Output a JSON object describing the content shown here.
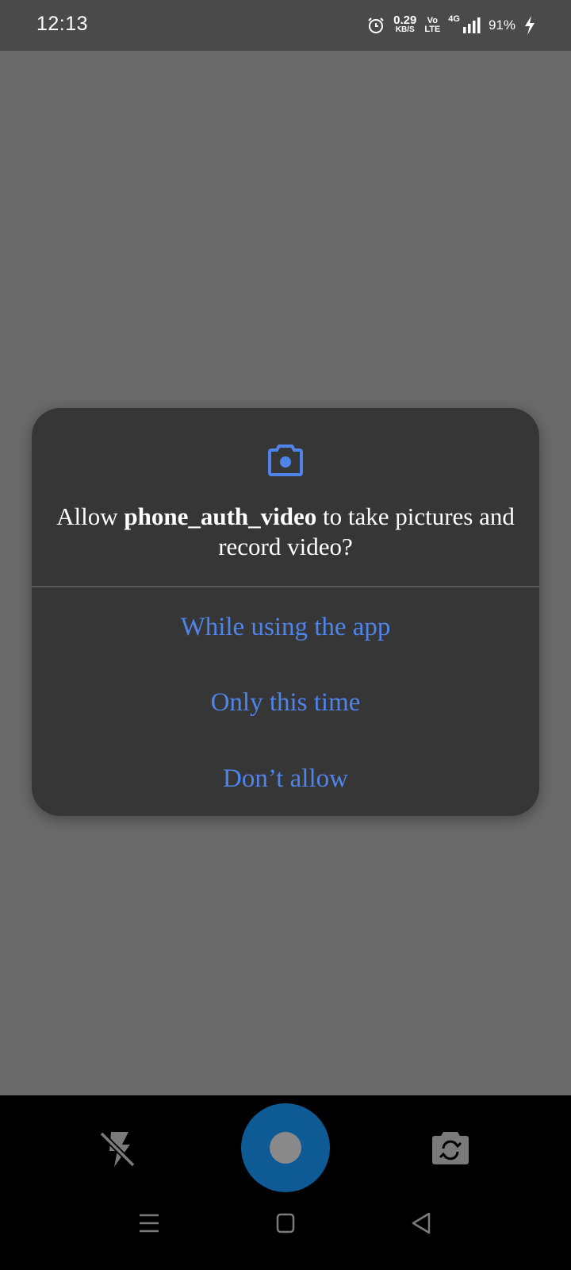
{
  "status_bar": {
    "time": "12:13",
    "net_speed_value": "0.29",
    "net_speed_unit": "KB/S",
    "volte_top": "Vo",
    "volte_bottom": "LTE",
    "network": "4G",
    "battery": "91%",
    "icons": [
      "alarm-icon",
      "signal-icon",
      "charging-icon"
    ]
  },
  "dialog": {
    "icon": "camera-icon",
    "message_prefix": "Allow ",
    "app_name": "phone_auth_video",
    "message_suffix": " to take pictures and record video?",
    "options": [
      "While using the app",
      "Only this time",
      "Don’t allow"
    ]
  },
  "camera_controls": {
    "icons": [
      "flash-off-icon",
      "shutter-button",
      "switch-camera-icon"
    ]
  },
  "nav_bar": {
    "icons": [
      "recents-icon",
      "home-icon",
      "back-icon"
    ]
  },
  "colors": {
    "accent": "#4f84ea",
    "dialog_bg": "#363636",
    "scrim": "#6a6a6a",
    "shutter": "#0d5a94"
  }
}
